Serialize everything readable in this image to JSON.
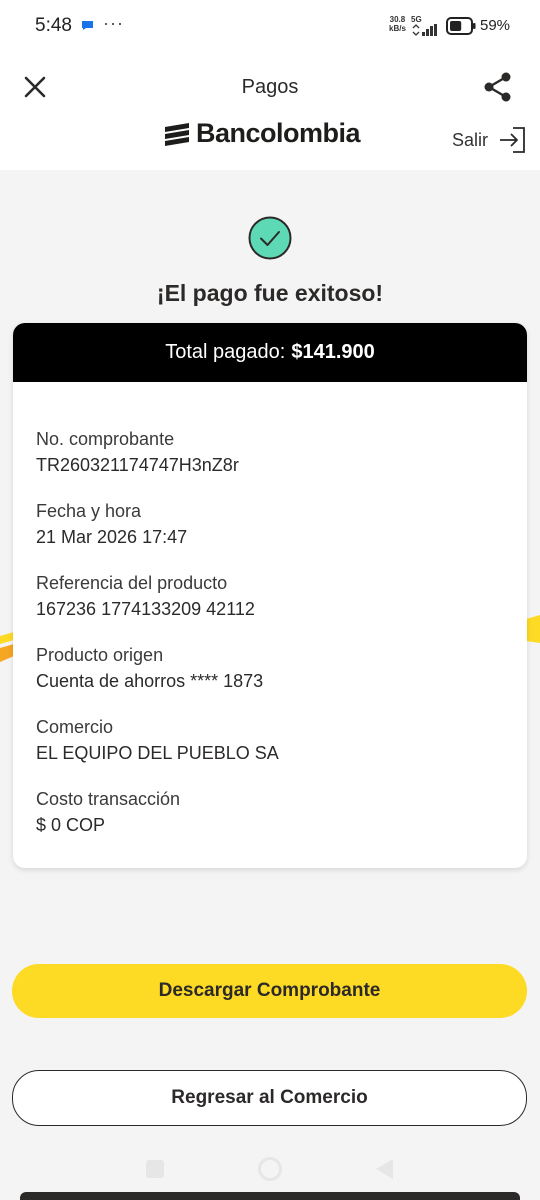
{
  "status_bar": {
    "time": "5:48",
    "dots": "···",
    "speed_value": "30.8",
    "speed_unit": "kB/s",
    "network": "5G",
    "battery_percent": "59%",
    "battery_level": 0.59
  },
  "header": {
    "title": "Pagos",
    "brand": "Bancolombia",
    "logout_label": "Salir"
  },
  "success": {
    "title": "¡El pago fue exitoso!"
  },
  "summary": {
    "total_label": "Total pagado:",
    "total_value": "$141.900",
    "fields": [
      {
        "label": "No. comprobante",
        "value": "TR260321174747H3nZ8r"
      },
      {
        "label": "Fecha y hora",
        "value": "21 Mar 2026 17:47"
      },
      {
        "label": "Referencia del producto",
        "value": "167236 1774133209 42112"
      },
      {
        "label": "Producto origen",
        "value": "Cuenta de ahorros **** 1873"
      },
      {
        "label": "Comercio",
        "value": "EL EQUIPO DEL PUEBLO SA"
      },
      {
        "label": "Costo transacción",
        "value": "$ 0 COP"
      }
    ]
  },
  "actions": {
    "download_label": "Descargar Comprobante",
    "back_label": "Regresar al Comercio"
  },
  "colors": {
    "brand_yellow": "#fdda24",
    "success_green": "#5ed9b5",
    "text_dark": "#2c2a29"
  }
}
